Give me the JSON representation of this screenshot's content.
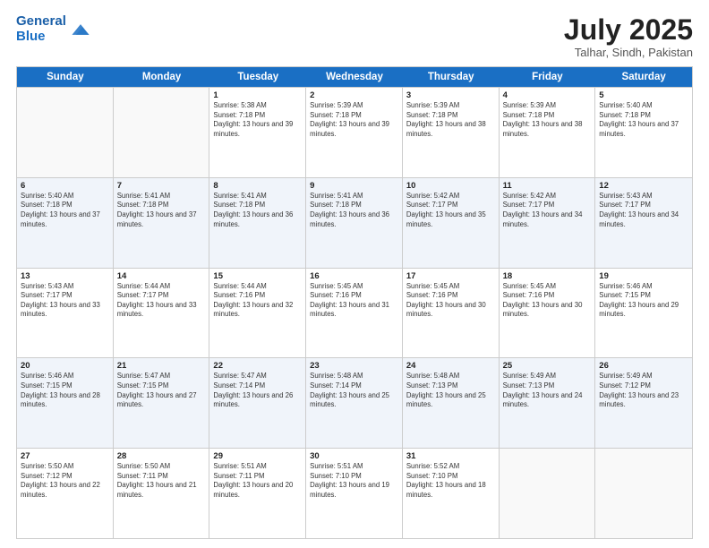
{
  "header": {
    "logo_line1": "General",
    "logo_line2": "Blue",
    "title": "July 2025",
    "subtitle": "Talhar, Sindh, Pakistan"
  },
  "calendar": {
    "days": [
      "Sunday",
      "Monday",
      "Tuesday",
      "Wednesday",
      "Thursday",
      "Friday",
      "Saturday"
    ],
    "rows": [
      [
        {
          "num": "",
          "info": ""
        },
        {
          "num": "",
          "info": ""
        },
        {
          "num": "1",
          "info": "Sunrise: 5:38 AM\nSunset: 7:18 PM\nDaylight: 13 hours and 39 minutes."
        },
        {
          "num": "2",
          "info": "Sunrise: 5:39 AM\nSunset: 7:18 PM\nDaylight: 13 hours and 39 minutes."
        },
        {
          "num": "3",
          "info": "Sunrise: 5:39 AM\nSunset: 7:18 PM\nDaylight: 13 hours and 38 minutes."
        },
        {
          "num": "4",
          "info": "Sunrise: 5:39 AM\nSunset: 7:18 PM\nDaylight: 13 hours and 38 minutes."
        },
        {
          "num": "5",
          "info": "Sunrise: 5:40 AM\nSunset: 7:18 PM\nDaylight: 13 hours and 37 minutes."
        }
      ],
      [
        {
          "num": "6",
          "info": "Sunrise: 5:40 AM\nSunset: 7:18 PM\nDaylight: 13 hours and 37 minutes."
        },
        {
          "num": "7",
          "info": "Sunrise: 5:41 AM\nSunset: 7:18 PM\nDaylight: 13 hours and 37 minutes."
        },
        {
          "num": "8",
          "info": "Sunrise: 5:41 AM\nSunset: 7:18 PM\nDaylight: 13 hours and 36 minutes."
        },
        {
          "num": "9",
          "info": "Sunrise: 5:41 AM\nSunset: 7:18 PM\nDaylight: 13 hours and 36 minutes."
        },
        {
          "num": "10",
          "info": "Sunrise: 5:42 AM\nSunset: 7:17 PM\nDaylight: 13 hours and 35 minutes."
        },
        {
          "num": "11",
          "info": "Sunrise: 5:42 AM\nSunset: 7:17 PM\nDaylight: 13 hours and 34 minutes."
        },
        {
          "num": "12",
          "info": "Sunrise: 5:43 AM\nSunset: 7:17 PM\nDaylight: 13 hours and 34 minutes."
        }
      ],
      [
        {
          "num": "13",
          "info": "Sunrise: 5:43 AM\nSunset: 7:17 PM\nDaylight: 13 hours and 33 minutes."
        },
        {
          "num": "14",
          "info": "Sunrise: 5:44 AM\nSunset: 7:17 PM\nDaylight: 13 hours and 33 minutes."
        },
        {
          "num": "15",
          "info": "Sunrise: 5:44 AM\nSunset: 7:16 PM\nDaylight: 13 hours and 32 minutes."
        },
        {
          "num": "16",
          "info": "Sunrise: 5:45 AM\nSunset: 7:16 PM\nDaylight: 13 hours and 31 minutes."
        },
        {
          "num": "17",
          "info": "Sunrise: 5:45 AM\nSunset: 7:16 PM\nDaylight: 13 hours and 30 minutes."
        },
        {
          "num": "18",
          "info": "Sunrise: 5:45 AM\nSunset: 7:16 PM\nDaylight: 13 hours and 30 minutes."
        },
        {
          "num": "19",
          "info": "Sunrise: 5:46 AM\nSunset: 7:15 PM\nDaylight: 13 hours and 29 minutes."
        }
      ],
      [
        {
          "num": "20",
          "info": "Sunrise: 5:46 AM\nSunset: 7:15 PM\nDaylight: 13 hours and 28 minutes."
        },
        {
          "num": "21",
          "info": "Sunrise: 5:47 AM\nSunset: 7:15 PM\nDaylight: 13 hours and 27 minutes."
        },
        {
          "num": "22",
          "info": "Sunrise: 5:47 AM\nSunset: 7:14 PM\nDaylight: 13 hours and 26 minutes."
        },
        {
          "num": "23",
          "info": "Sunrise: 5:48 AM\nSunset: 7:14 PM\nDaylight: 13 hours and 25 minutes."
        },
        {
          "num": "24",
          "info": "Sunrise: 5:48 AM\nSunset: 7:13 PM\nDaylight: 13 hours and 25 minutes."
        },
        {
          "num": "25",
          "info": "Sunrise: 5:49 AM\nSunset: 7:13 PM\nDaylight: 13 hours and 24 minutes."
        },
        {
          "num": "26",
          "info": "Sunrise: 5:49 AM\nSunset: 7:12 PM\nDaylight: 13 hours and 23 minutes."
        }
      ],
      [
        {
          "num": "27",
          "info": "Sunrise: 5:50 AM\nSunset: 7:12 PM\nDaylight: 13 hours and 22 minutes."
        },
        {
          "num": "28",
          "info": "Sunrise: 5:50 AM\nSunset: 7:11 PM\nDaylight: 13 hours and 21 minutes."
        },
        {
          "num": "29",
          "info": "Sunrise: 5:51 AM\nSunset: 7:11 PM\nDaylight: 13 hours and 20 minutes."
        },
        {
          "num": "30",
          "info": "Sunrise: 5:51 AM\nSunset: 7:10 PM\nDaylight: 13 hours and 19 minutes."
        },
        {
          "num": "31",
          "info": "Sunrise: 5:52 AM\nSunset: 7:10 PM\nDaylight: 13 hours and 18 minutes."
        },
        {
          "num": "",
          "info": ""
        },
        {
          "num": "",
          "info": ""
        }
      ]
    ]
  }
}
